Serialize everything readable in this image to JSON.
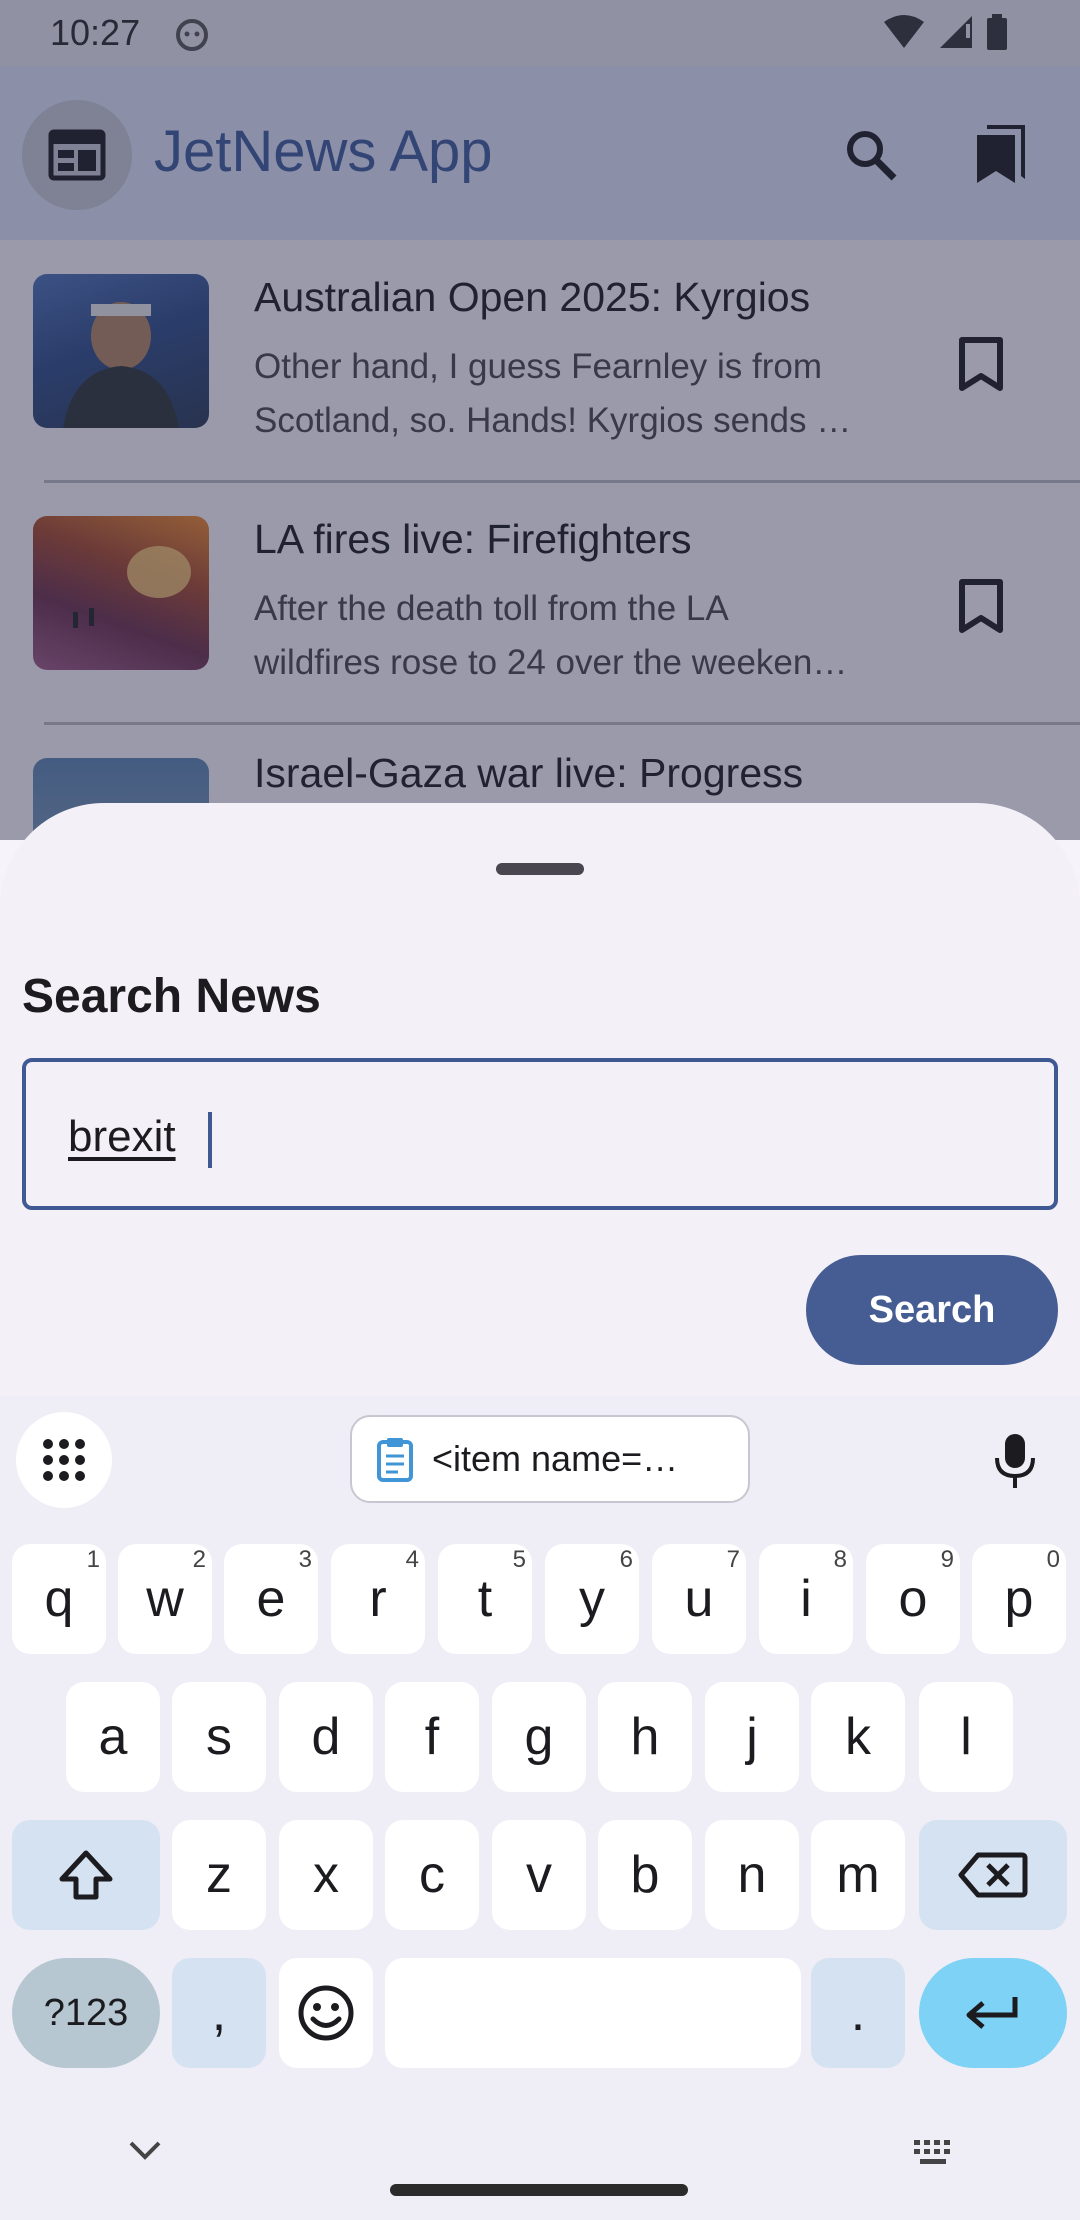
{
  "status_bar": {
    "time": "10:27",
    "icons": [
      "cat-face-icon",
      "wifi-icon",
      "signal-icon",
      "battery-icon"
    ]
  },
  "app_bar": {
    "title": "JetNews App",
    "icons": [
      "newspaper-icon",
      "search-icon",
      "bookmarks-icon"
    ]
  },
  "articles": [
    {
      "title": "Australian Open 2025: Kyrgios",
      "desc_line1": "Other hand, I guess Fearnley is from",
      "desc_line2": "Scotland, so. Hands! Kyrgios sends …"
    },
    {
      "title": "LA fires live: Firefighters",
      "desc_line1": "After the death toll from the LA",
      "desc_line2": "wildfires rose to 24 over the weeken…"
    },
    {
      "title": "Israel-Gaza war live: Progress"
    }
  ],
  "sheet": {
    "heading": "Search News",
    "input_value": "brexit",
    "button_label": "Search"
  },
  "keyboard": {
    "clipboard_text": "<item name=…",
    "row1": [
      {
        "key": "q",
        "hint": "1"
      },
      {
        "key": "w",
        "hint": "2"
      },
      {
        "key": "e",
        "hint": "3"
      },
      {
        "key": "r",
        "hint": "4"
      },
      {
        "key": "t",
        "hint": "5"
      },
      {
        "key": "y",
        "hint": "6"
      },
      {
        "key": "u",
        "hint": "7"
      },
      {
        "key": "i",
        "hint": "8"
      },
      {
        "key": "o",
        "hint": "9"
      },
      {
        "key": "p",
        "hint": "0"
      }
    ],
    "row2": [
      "a",
      "s",
      "d",
      "f",
      "g",
      "h",
      "j",
      "k",
      "l"
    ],
    "row3": [
      "z",
      "x",
      "c",
      "v",
      "b",
      "n",
      "m"
    ],
    "symbols_label": "?123",
    "comma": ",",
    "period": "."
  },
  "colors": {
    "accent": "#465d94",
    "title_blue": "#3e5b9b",
    "sheet_bg": "#f4f0f8",
    "enter_key": "#7dd2f5"
  }
}
